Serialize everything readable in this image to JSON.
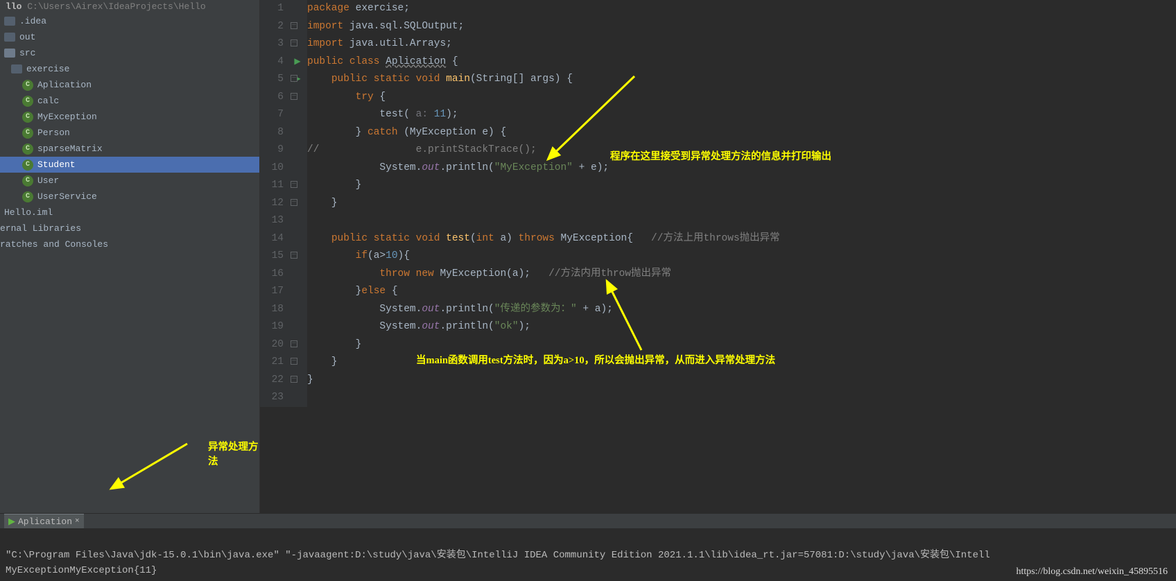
{
  "breadcrumb": {
    "prefix_bold": "llo",
    "path": "C:\\Users\\Airex\\IdeaProjects\\Hello"
  },
  "tree": [
    {
      "depth": 0,
      "icon": "folder-dark",
      "label": ".idea"
    },
    {
      "depth": 0,
      "icon": "folder-dark",
      "label": "out"
    },
    {
      "depth": 0,
      "icon": "folder",
      "label": "src"
    },
    {
      "depth": 1,
      "icon": "folder-dark",
      "label": "exercise"
    },
    {
      "depth": 2,
      "icon": "class",
      "label": "Aplication"
    },
    {
      "depth": 2,
      "icon": "class",
      "label": "calc"
    },
    {
      "depth": 2,
      "icon": "class",
      "label": "MyException"
    },
    {
      "depth": 2,
      "icon": "class",
      "label": "Person"
    },
    {
      "depth": 2,
      "icon": "class",
      "label": "sparseMatrix"
    },
    {
      "depth": 2,
      "icon": "class",
      "label": "Student",
      "selected": true
    },
    {
      "depth": 2,
      "icon": "class",
      "label": "User"
    },
    {
      "depth": 2,
      "icon": "class",
      "label": "UserService"
    },
    {
      "depth": 0,
      "icon": "none",
      "label": "Hello.iml"
    },
    {
      "depth": 0,
      "icon": "none",
      "label": "ernal Libraries",
      "cut": true
    },
    {
      "depth": 0,
      "icon": "none",
      "label": "ratches and Consoles",
      "cut": true
    }
  ],
  "code": [
    {
      "n": 1,
      "run": false,
      "fold": false,
      "html": "<span class='kw'>package</span> exercise;"
    },
    {
      "n": 2,
      "run": false,
      "fold": "⊖",
      "html": "<span class='kw'>import</span> java.sql.SQLOutput;"
    },
    {
      "n": 3,
      "run": false,
      "fold": "⊟",
      "html": "<span class='kw'>import</span> java.util.Arrays;"
    },
    {
      "n": 4,
      "run": true,
      "fold": "",
      "html": "<span class='kw'>public class</span> <span class='id und'>Aplication</span> {"
    },
    {
      "n": 5,
      "run": true,
      "fold": "⊖",
      "html": "    <span class='kw'>public static void</span> <span class='mth'>main</span>(String[] args) {"
    },
    {
      "n": 6,
      "run": false,
      "fold": "⊖",
      "html": "        <span class='kw'>try</span> {"
    },
    {
      "n": 7,
      "run": false,
      "fold": "",
      "html": "            <span class='id'>test</span>( <span class='par'>a:</span> <span class='num'>11</span>);"
    },
    {
      "n": 8,
      "run": false,
      "fold": "",
      "html": "        } <span class='kw'>catch</span> (MyException e) {"
    },
    {
      "n": 9,
      "run": false,
      "fold": "",
      "html": "<span class='cm'>//                e.printStackTrace();</span>"
    },
    {
      "n": 10,
      "run": false,
      "fold": "",
      "html": "            System.<span class='fld'>out</span>.println(<span class='str'>\"MyException\"</span> + e);"
    },
    {
      "n": 11,
      "run": false,
      "fold": "⊟",
      "html": "        }"
    },
    {
      "n": 12,
      "run": false,
      "fold": "⊟",
      "html": "    }"
    },
    {
      "n": 13,
      "run": false,
      "fold": "",
      "html": ""
    },
    {
      "n": 14,
      "run": false,
      "fold": "",
      "html": "    <span class='kw'>public static void</span> <span class='mth'>test</span>(<span class='kw'>int</span> a) <span class='kw'>throws</span> MyException{   <span class='cm'>//方法上用throws抛出异常</span>"
    },
    {
      "n": 15,
      "run": false,
      "fold": "⊖",
      "html": "        <span class='kw'>if</span>(a&gt;<span class='num'>10</span>){"
    },
    {
      "n": 16,
      "run": false,
      "fold": "",
      "html": "            <span class='kw'>throw new</span> MyException(a);   <span class='cm'>//方法内用throw抛出异常</span>"
    },
    {
      "n": 17,
      "run": false,
      "fold": "",
      "html": "        }<span class='kw'>else</span> {"
    },
    {
      "n": 18,
      "run": false,
      "fold": "",
      "html": "            System.<span class='fld'>out</span>.println(<span class='str'>\"传递的参数为：\"</span> + a);"
    },
    {
      "n": 19,
      "run": false,
      "fold": "",
      "html": "            System.<span class='fld'>out</span>.println(<span class='str'>\"ok\"</span>);"
    },
    {
      "n": 20,
      "run": false,
      "fold": "⊟",
      "html": "        }"
    },
    {
      "n": 21,
      "run": false,
      "fold": "⊟",
      "html": "    }"
    },
    {
      "n": 22,
      "run": false,
      "fold": "⊟",
      "html": "}"
    },
    {
      "n": 23,
      "run": false,
      "fold": "",
      "html": ""
    }
  ],
  "annotations": {
    "top": "程序在这里接受到异常处理方法的信息并打印输出",
    "mid": "当main函数调用test方法时，因为a>10，所以会抛出异常，从而进入异常处理方法",
    "side": "异常处理方法"
  },
  "run_tab": {
    "label": "Aplication"
  },
  "console": {
    "line1": "\"C:\\Program Files\\Java\\jdk-15.0.1\\bin\\java.exe\" \"-javaagent:D:\\study\\java\\安装包\\IntelliJ IDEA Community Edition 2021.1.1\\lib\\idea_rt.jar=57081:D:\\study\\java\\安装包\\Intell",
    "line2": "MyExceptionMyException{11}"
  },
  "watermark": "https://blog.csdn.net/weixin_45895516"
}
